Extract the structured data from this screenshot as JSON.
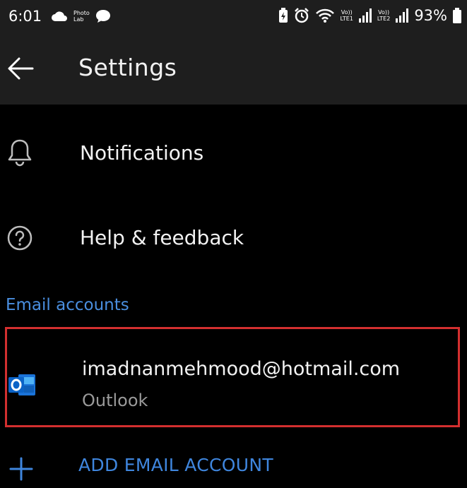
{
  "status_bar": {
    "time": "6:01",
    "notification_app_label": "Photo\nLab",
    "sim1_label": "Vo))\nLTE1",
    "sim2_label": "Vo))\nLTE2",
    "battery_percent": "93%"
  },
  "app_bar": {
    "title": "Settings",
    "back_icon": "arrow-left-icon"
  },
  "settings_items": [
    {
      "label": "Notifications",
      "icon": "bell-icon"
    },
    {
      "label": "Help & feedback",
      "icon": "help-circle-icon"
    }
  ],
  "email_section": {
    "header": "Email accounts",
    "accounts": [
      {
        "email": "imadnanmehmood@hotmail.com",
        "type": "Outlook",
        "icon": "outlook-icon"
      }
    ],
    "add_account_label": "ADD EMAIL ACCOUNT",
    "add_icon": "plus-icon"
  },
  "colors": {
    "accent": "#3f86de",
    "highlight_border": "#d32f2f",
    "app_bar_bg": "#1e1e1e",
    "background": "#000000"
  }
}
